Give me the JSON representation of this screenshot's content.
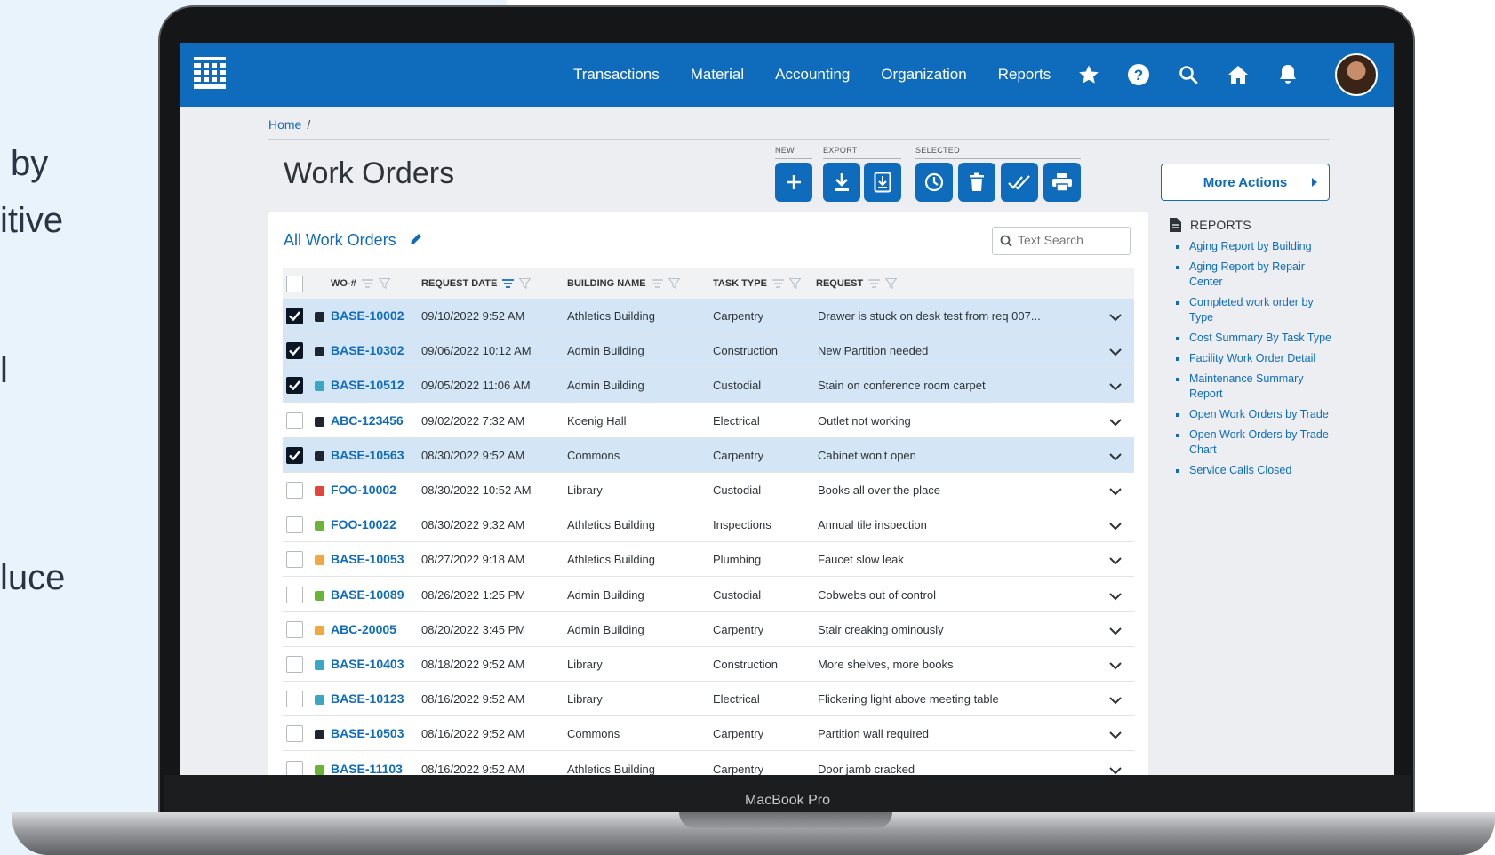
{
  "marketing": {
    "line1": "by",
    "line2": "itive",
    "line3": "l",
    "line4": "luce"
  },
  "device_label": "MacBook Pro",
  "nav": {
    "links": [
      "Transactions",
      "Material",
      "Accounting",
      "Organization",
      "Reports"
    ],
    "icons": [
      "star-icon",
      "help-icon",
      "search-icon",
      "home-icon",
      "bell-icon"
    ]
  },
  "breadcrumb": {
    "home": "Home",
    "separator": "/"
  },
  "page_title": "Work Orders",
  "toolbar": {
    "group_new": "NEW",
    "group_export": "EXPORT",
    "group_selected": "SELECTED",
    "more_actions": "More Actions"
  },
  "list_title": "All Work Orders",
  "search": {
    "placeholder": "Text Search"
  },
  "columns": {
    "wo": "WO-#",
    "date": "REQUEST DATE",
    "building": "BUILDING NAME",
    "task": "TASK TYPE",
    "request": "REQUEST"
  },
  "rows": [
    {
      "wo": "BASE-10002",
      "date": "09/10/2022 9:52 AM",
      "building": "Athletics Building",
      "task": "Carpentry",
      "request": "Drawer is stuck on desk test from req 007...",
      "checked": true,
      "status_color": "#1d2530"
    },
    {
      "wo": "BASE-10302",
      "date": "09/06/2022 10:12 AM",
      "building": "Admin Building",
      "task": "Construction",
      "request": "New Partition needed",
      "checked": true,
      "status_color": "#1d2530"
    },
    {
      "wo": "BASE-10512",
      "date": "09/05/2022 11:06 AM",
      "building": "Admin Building",
      "task": "Custodial",
      "request": "Stain on conference room carpet",
      "checked": true,
      "status_color": "#3aa7c4"
    },
    {
      "wo": "ABC-123456",
      "date": "09/02/2022 7:32 AM",
      "building": "Koenig Hall",
      "task": "Electrical",
      "request": "Outlet not working",
      "checked": false,
      "status_color": "#1d2530"
    },
    {
      "wo": "BASE-10563",
      "date": "08/30/2022 9:52 AM",
      "building": "Commons",
      "task": "Carpentry",
      "request": "Cabinet won't open",
      "checked": true,
      "status_color": "#1d2530"
    },
    {
      "wo": "FOO-10002",
      "date": "08/30/2022 10:52 AM",
      "building": "Library",
      "task": "Custodial",
      "request": "Books all over the place",
      "checked": false,
      "status_color": "#e2453c"
    },
    {
      "wo": "FOO-10022",
      "date": "08/30/2022 9:32 AM",
      "building": "Athletics Building",
      "task": "Inspections",
      "request": "Annual tile inspection",
      "checked": false,
      "status_color": "#6bb43a"
    },
    {
      "wo": "BASE-10053",
      "date": "08/27/2022 9:18 AM",
      "building": "Athletics Building",
      "task": "Plumbing",
      "request": "Faucet slow leak",
      "checked": false,
      "status_color": "#f0a840"
    },
    {
      "wo": "BASE-10089",
      "date": "08/26/2022 1:25 PM",
      "building": "Admin Building",
      "task": "Custodial",
      "request": "Cobwebs out of control",
      "checked": false,
      "status_color": "#6bb43a"
    },
    {
      "wo": "ABC-20005",
      "date": "08/20/2022 3:45 PM",
      "building": "Admin Building",
      "task": "Carpentry",
      "request": "Stair creaking ominously",
      "checked": false,
      "status_color": "#f0a840"
    },
    {
      "wo": "BASE-10403",
      "date": "08/18/2022 9:52 AM",
      "building": "Library",
      "task": "Construction",
      "request": "More shelves, more books",
      "checked": false,
      "status_color": "#3aa7c4"
    },
    {
      "wo": "BASE-10123",
      "date": "08/16/2022 9:52 AM",
      "building": "Library",
      "task": "Electrical",
      "request": "Flickering light above meeting table",
      "checked": false,
      "status_color": "#3aa7c4"
    },
    {
      "wo": "BASE-10503",
      "date": "08/16/2022 9:52 AM",
      "building": "Commons",
      "task": "Carpentry",
      "request": "Partition wall required",
      "checked": false,
      "status_color": "#1d2530"
    },
    {
      "wo": "BASE-11103",
      "date": "08/16/2022 9:52 AM",
      "building": "Athletics Building",
      "task": "Carpentry",
      "request": "Door jamb cracked",
      "checked": false,
      "status_color": "#6bb43a"
    }
  ],
  "reports": {
    "heading": "REPORTS",
    "items": [
      "Aging Report by Building",
      "Aging Report by Repair Center",
      "Completed work order by Type",
      "Cost Summary By Task Type",
      "Facility Work Order Detail",
      "Maintenance Summary Report",
      "Open Work Orders by Trade",
      "Open Work Orders by Trade Chart",
      "Service Calls Closed"
    ]
  }
}
